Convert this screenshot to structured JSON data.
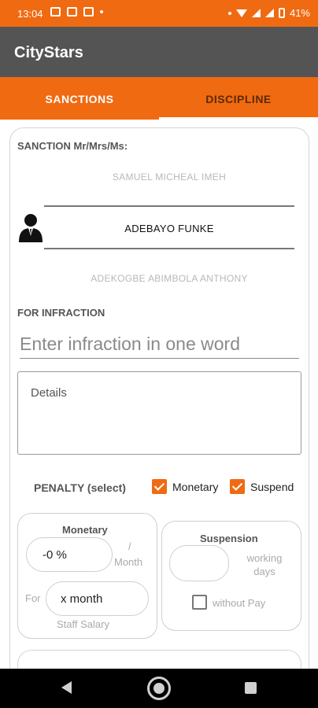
{
  "status_bar": {
    "time": "13:04",
    "battery": "41%"
  },
  "app": {
    "title": "CityStars"
  },
  "tabs": [
    {
      "label": "SANCTIONS",
      "selected": true
    },
    {
      "label": "DISCIPLINE",
      "selected": false
    }
  ],
  "sanction": {
    "label": "SANCTION Mr/Mrs/Ms:",
    "names": [
      "SAMUEL MICHEAL IMEH",
      "ADEBAYO FUNKE",
      "ADEKOGBE ABIMBOLA ANTHONY"
    ],
    "selected_index": 1
  },
  "infraction": {
    "label": "FOR INFRACTION",
    "placeholder": "Enter infraction in one word",
    "value": ""
  },
  "details": {
    "placeholder": "Details",
    "value": ""
  },
  "penalty": {
    "label": "PENALTY (select)",
    "options": [
      {
        "label": "Monetary",
        "checked": true
      },
      {
        "label": "Suspend",
        "checked": true
      }
    ]
  },
  "monetary": {
    "title": "Monetary",
    "percent_value": "-0 %",
    "slash": "/",
    "per_month": "Month",
    "for_label": "For",
    "months_value": "x month",
    "salary_label": "Staff Salary"
  },
  "suspension": {
    "title": "Suspension",
    "days_value": "",
    "working_days": "working days",
    "without_pay_label": "without Pay",
    "without_pay_checked": false
  },
  "colors": {
    "accent": "#f06a12",
    "appbar": "#545454",
    "tab_inactive_text": "#5d2a05"
  },
  "icons": {
    "sanctioned_person": "person-suit-icon",
    "nav_back": "triangle-back-icon",
    "nav_home": "circle-home-icon",
    "nav_recents": "square-recents-icon"
  }
}
